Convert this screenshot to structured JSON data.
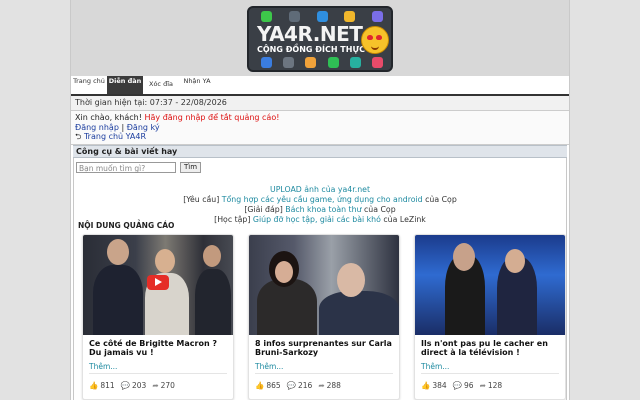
{
  "logo": {
    "title": "YA4R.NET",
    "subtitle": "CỘNG ĐỒNG ĐÍCH THỰC"
  },
  "nav": [
    {
      "label": "Trang chủ",
      "active": false
    },
    {
      "label": "Diễn đàn",
      "active": true
    },
    {
      "label": "Xóc đĩa",
      "active": false
    },
    {
      "label": "Nhận YA",
      "active": false
    }
  ],
  "time": {
    "text": "Thời gian hiện tại: 07:37 - 22/08/2026"
  },
  "greeting": {
    "hello": "Xin chào, khách!",
    "notice": "Hãy đăng nhập để tắt quảng cáo!",
    "login": "Đăng nhập",
    "sep": "|",
    "register": "Đăng ký",
    "home": "Trang chủ YA4R"
  },
  "section": {
    "title": "Công cụ & bài viết hay"
  },
  "search": {
    "placeholder": "Bạn muốn tìm gì?",
    "button": "Tìm"
  },
  "links": {
    "upload": "UPLOAD ảnh của ya4r.net",
    "l1_prefix": "[Yêu cầu]",
    "l1_link": "Tổng hợp các yêu cầu game, ứng dụng cho android",
    "l1_suffix": "của Cọp",
    "l2_prefix": "[Giải đáp]",
    "l2_link": "Bách khoa toàn thư",
    "l2_suffix": "của Cọp",
    "l3_prefix": "[Học tập]",
    "l3_link": "Giúp đỡ học tập, giải các bài khó",
    "l3_suffix": "của LeZink"
  },
  "ads": {
    "title": "NỘI DUNG QUẢNG CÁO",
    "cards": [
      {
        "title": "Ce côté de Brigitte Macron ? Du jamais vu !",
        "more": "Thêm...",
        "likes": "811",
        "comments": "203",
        "shares": "270"
      },
      {
        "title": "8 infos surprenantes sur Carla Bruni-Sarkozy",
        "more": "Thêm...",
        "likes": "865",
        "comments": "216",
        "shares": "288"
      },
      {
        "title": "Ils n'ont pas pu le cacher en direct à la télévision !",
        "more": "Thêm...",
        "likes": "384",
        "comments": "96",
        "shares": "128"
      }
    ]
  }
}
